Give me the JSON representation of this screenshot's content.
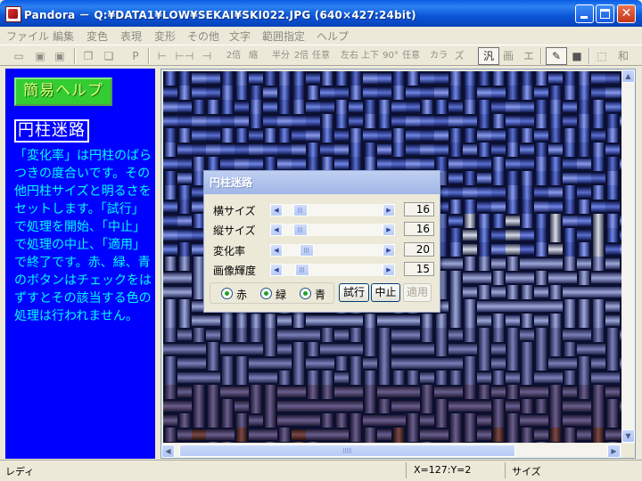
{
  "window": {
    "title": "Pandora － Q:¥DATA1¥LOW¥SEKAI¥SKI022.JPG (640×427:24bit)",
    "icon": "pandora-app-icon",
    "controls": [
      "minimize-icon",
      "maximize-icon",
      "close-icon"
    ]
  },
  "menu": [
    "ファイル",
    "編集",
    "変色",
    "表現",
    "変形",
    "その他",
    "文字",
    "範囲指定",
    "ヘルプ"
  ],
  "toolbar": [
    {
      "label": "",
      "icon": "open-folder-icon"
    },
    {
      "label": "",
      "icon": "save-disk-icon"
    },
    {
      "label": "",
      "icon": "save-as-disk-icon"
    },
    {
      "label": "",
      "icon": "copy-icon"
    },
    {
      "label": "",
      "icon": "paste-icon"
    },
    {
      "label": "P",
      "icon": "p-icon"
    },
    {
      "label": "⊢",
      "icon": "left-edge-icon"
    },
    {
      "label": "⊢⊣",
      "icon": "width-icon"
    },
    {
      "label": "⊣",
      "icon": "right-edge-icon"
    },
    {
      "label": "2倍",
      "icon": "zoom-2x-icon"
    },
    {
      "label": "縮",
      "icon": "shrink-icon"
    },
    {
      "label": "半分",
      "icon": "half-icon"
    },
    {
      "label": "2倍",
      "icon": "double-icon"
    },
    {
      "label": "任意",
      "icon": "custom-size-icon"
    },
    {
      "label": "左右",
      "icon": "flip-horizontal-icon"
    },
    {
      "label": "上下",
      "icon": "flip-vertical-icon"
    },
    {
      "label": "90°",
      "icon": "rotate-90-icon"
    },
    {
      "label": "任意",
      "icon": "rotate-custom-icon"
    },
    {
      "label": "カラ",
      "icon": "color-icon"
    },
    {
      "label": "ズ",
      "icon": "zoom-icon"
    },
    {
      "label": "汎",
      "icon": "general-icon"
    },
    {
      "label": "画",
      "icon": "image-icon"
    },
    {
      "label": "エ",
      "icon": "effect-icon"
    },
    {
      "label": "",
      "icon": "paint-icon"
    },
    {
      "label": "",
      "icon": "fill-square-icon"
    },
    {
      "label": "",
      "icon": "select-rect-icon"
    },
    {
      "label": "和",
      "icon": "japanese-icon"
    }
  ],
  "help": {
    "button_label": "簡易ヘルプ",
    "title": "円柱迷路",
    "body": "「変化率」は円柱のばらつきの度合いです。その他円柱サイズと明るさをセットします。「試行」で処理を開始、「中止」で処理の中止、「適用」で終了です。赤、緑、青のボタンはチェックをはずすとその該当する色の処理は行われません。"
  },
  "dialog": {
    "title": "円柱迷路",
    "sliders": [
      {
        "label": "横サイズ",
        "value": "16",
        "fraction": 0.12
      },
      {
        "label": "縦サイズ",
        "value": "16",
        "fraction": 0.12
      },
      {
        "label": "変化率",
        "value": "20",
        "fraction": 0.2
      },
      {
        "label": "画像輝度",
        "value": "15",
        "fraction": 0.15
      }
    ],
    "channels": [
      {
        "label": "赤",
        "checked": true
      },
      {
        "label": "緑",
        "checked": true
      },
      {
        "label": "青",
        "checked": true
      }
    ],
    "buttons": {
      "try": "試行",
      "stop": "中止",
      "apply": "適用"
    }
  },
  "statusbar": {
    "status": "レディ",
    "coords": "X=127:Y=2",
    "size_label": "サイズ"
  },
  "colors": {
    "help_background": "#0000ff",
    "help_text": "#00ffff",
    "help_button": "#33cc33",
    "weave_blue": "#3a4fb4",
    "weave_brown": "#5a2a28"
  }
}
